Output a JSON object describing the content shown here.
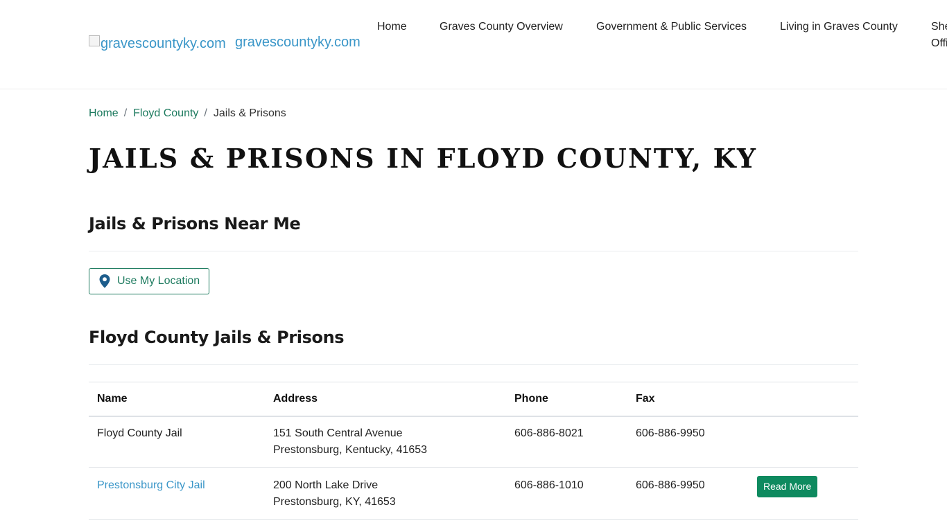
{
  "header": {
    "logo_alt": "gravescountyky.com",
    "site_name": "gravescountyky.com",
    "nav": [
      {
        "label": "Home"
      },
      {
        "label": "Graves County Overview"
      },
      {
        "label": "Government & Public Services"
      },
      {
        "label": "Living in Graves County"
      },
      {
        "label": "Sheriff Office"
      }
    ]
  },
  "breadcrumb": {
    "items": [
      "Home",
      "Floyd County"
    ],
    "separator": "/",
    "current": "Jails & Prisons"
  },
  "page_title": "JAILS & PRISONS IN FLOYD COUNTY, KY",
  "near_me": {
    "heading": "Jails & Prisons Near Me",
    "button_label": "Use My Location",
    "button_icon": "map-pin-icon"
  },
  "listing": {
    "heading": "Floyd County Jails & Prisons",
    "columns": [
      "Name",
      "Address",
      "Phone",
      "Fax",
      ""
    ],
    "rows": [
      {
        "name": "Floyd County Jail",
        "is_link": false,
        "address_line1": "151 South Central Avenue",
        "address_line2": "Prestonsburg, Kentucky, 41653",
        "phone": "606-886-8021",
        "fax": "606-886-9950",
        "action": ""
      },
      {
        "name": "Prestonsburg City Jail",
        "is_link": true,
        "address_line1": "200 North Lake Drive",
        "address_line2": "Prestonsburg, KY, 41653",
        "phone": "606-886-1010",
        "fax": "606-886-9950",
        "action": "Read More"
      }
    ]
  },
  "colors": {
    "accent_green": "#1c7a5e",
    "button_green": "#0e8a5f",
    "link_blue": "#3a96c8",
    "pin_blue": "#1d5d8c"
  }
}
